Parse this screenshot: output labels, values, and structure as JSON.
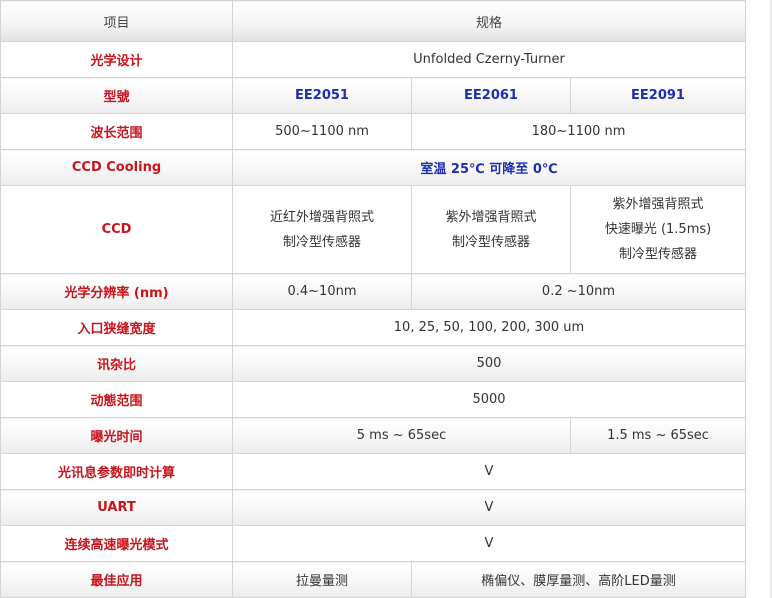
{
  "header": {
    "col1": "项目",
    "col2": "规格"
  },
  "rows": {
    "optical_design": {
      "label": "光学设计",
      "value": "Unfolded Czerny-Turner"
    },
    "model": {
      "label": "型號",
      "v1": "EE2051",
      "v2": "EE2061",
      "v3": "EE2091"
    },
    "wavelength": {
      "label": "波长范围",
      "v1": "500~1100 nm",
      "v23": "180~1100 nm"
    },
    "ccd_cooling": {
      "label": "CCD Cooling",
      "value": "室温 25℃ 可降至 0℃"
    },
    "ccd": {
      "label": "CCD",
      "v1": [
        "近红外增强背照式",
        "制冷型传感器"
      ],
      "v2": [
        "紫外增强背照式",
        "制冷型传感器"
      ],
      "v3": [
        "紫外增强背照式",
        "快速曝光 (1.5ms)",
        "制冷型传感器"
      ]
    },
    "resolution": {
      "label": "光学分辨率 (nm)",
      "v1": "0.4~10nm",
      "v23": "0.2 ~10nm"
    },
    "slit": {
      "label": "入口狭缝宽度",
      "value": "10, 25, 50, 100, 200, 300 um"
    },
    "snr": {
      "label": "讯杂比",
      "value": "500"
    },
    "dynamic_range": {
      "label": "动態范围",
      "value": "5000"
    },
    "exposure": {
      "label": "曝光时间",
      "v12": "5 ms ~ 65sec",
      "v3": "1.5 ms ~ 65sec"
    },
    "realtime_calc": {
      "label": "光讯息参数即时计算",
      "value": "V"
    },
    "uart": {
      "label": "UART",
      "value": "V"
    },
    "burst_mode": {
      "label": "连续高速曝光模式",
      "value": "V"
    },
    "application": {
      "label": "最佳应用",
      "v1": "拉曼量测",
      "v23": "椭偏仪、膜厚量测、高阶LED量测"
    }
  },
  "colors": {
    "label_red": "#c8151d",
    "model_blue": "#1c2fae",
    "border": "#d4d4d4"
  }
}
